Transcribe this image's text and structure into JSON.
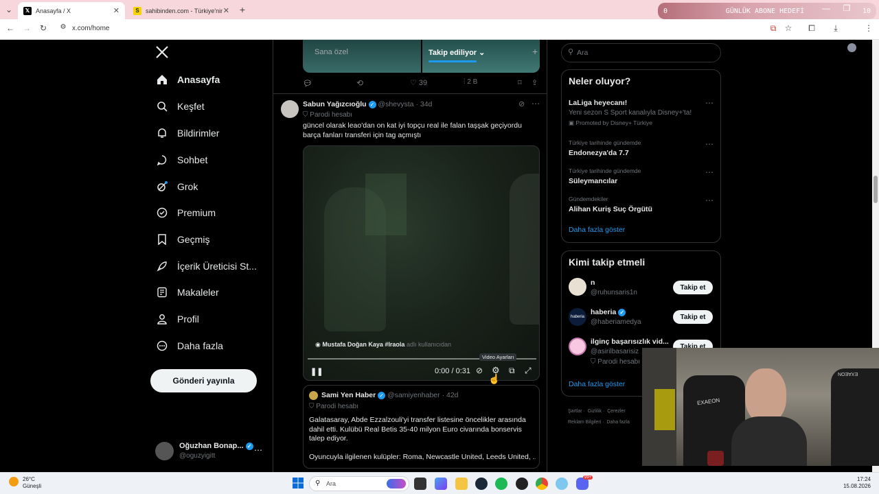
{
  "browser": {
    "tabs": [
      {
        "title": "Anasayfa / X",
        "active": true
      },
      {
        "title": "sahibinden.com - Türkiye'nin O",
        "active": false
      }
    ],
    "new_tab": "+",
    "url": "x.com/home",
    "overlay": {
      "count_left": "0",
      "label": "GÜNLÜK ABONE HEDEFİ",
      "count_right": "10"
    }
  },
  "nav": {
    "items": [
      {
        "label": "Anasayfa",
        "icon": "home-icon"
      },
      {
        "label": "Keşfet",
        "icon": "search-icon"
      },
      {
        "label": "Bildirimler",
        "icon": "bell-icon"
      },
      {
        "label": "Sohbet",
        "icon": "chat-icon"
      },
      {
        "label": "Grok",
        "icon": "grok-icon"
      },
      {
        "label": "Premium",
        "icon": "premium-icon"
      },
      {
        "label": "Geçmiş",
        "icon": "bookmark-icon"
      },
      {
        "label": "İçerik Üreticisi St...",
        "icon": "rocket-icon"
      },
      {
        "label": "Makaleler",
        "icon": "article-icon"
      },
      {
        "label": "Profil",
        "icon": "profile-icon"
      },
      {
        "label": "Daha fazla",
        "icon": "more-circle-icon"
      }
    ],
    "post_button": "Gönderi yayınla",
    "account": {
      "name": "Oğuzhan Bonap...",
      "handle": "@oguzyigitt"
    }
  },
  "feed": {
    "tabs": [
      "Sana özel",
      "Takip ediliyor"
    ],
    "prev_post_stats": {
      "replies": "",
      "reposts": "",
      "likes": "39",
      "views": "2 B"
    },
    "post": {
      "author": "Sabun Yağızcıoğlu",
      "handle": "@shevysta",
      "age": "34d",
      "badge": "Parodi hesabı",
      "text": "güncel olarak leao'dan on kat iyi topçu real ile falan taşşak geçiyordu barça fanları transferi için tag açmıştı",
      "video": {
        "attribution_user": "Mustafa Doğan Kaya #Iraola",
        "attribution_suffix": "adlı kullanıcıdan",
        "time": "0:00 / 0:31",
        "tooltip": "Video Ayarları"
      }
    },
    "quote": {
      "author": "Sami Yen Haber",
      "handle": "@samiyenhaber",
      "age": "42d",
      "badge": "Parodi hesabı",
      "text1": "Galatasaray, Abde Ezzalzouli'yi transfer listesine öncelikler arasında dahil etti. Kulübü Real Betis 35-40 milyon Euro civarında bonservis talep ediyor.",
      "text2": "Oyuncuyla ilgilenen kulüpler: Roma, Newcastle United, Leeds United, ..."
    }
  },
  "right": {
    "search_placeholder": "Ara",
    "trends_title": "Neler oluyor?",
    "trends": [
      {
        "title": "LaLiga heyecanı!",
        "desc": "Yeni sezon S Sport kanalıyla Disney+'ta!",
        "promo": "Promoted by Disney+ Türkiye"
      },
      {
        "context": "Türkiye tarihinde gündemde",
        "title": "Endonezya'da 7.7"
      },
      {
        "context": "Türkiye tarihinde gündemde",
        "title": "Süleymancılar"
      },
      {
        "context": "Gündemdekiler",
        "title": "Alihan Kuriş Suç Örgütü"
      }
    ],
    "show_more": "Daha fazla göster",
    "who_title": "Kimi takip etmeli",
    "who": [
      {
        "name": "n",
        "handle": "@ruhunsaris1n"
      },
      {
        "name": "haberia",
        "handle": "@haberiamedya",
        "avatar_text": "haberia"
      },
      {
        "name": "ilginç başarısızlık vid...",
        "handle": "@asirilbasarisiz",
        "badge": "Parodi hesabı"
      }
    ],
    "follow_label": "Takip et",
    "who_show_more": "Daha fazla göster",
    "footer": [
      "Şartlar",
      "Gizlilik",
      "Çerezler",
      "Reklam Bilgileri",
      "Daha fazla"
    ]
  },
  "webcam": {
    "headset_text": "EXAEON",
    "chair_text": "EXAEON"
  },
  "taskbar": {
    "weather_temp": "26°C",
    "weather_desc": "Güneşli",
    "search": "Ara",
    "time": "17:24",
    "date": "15.08.2026",
    "badge": "99+"
  }
}
